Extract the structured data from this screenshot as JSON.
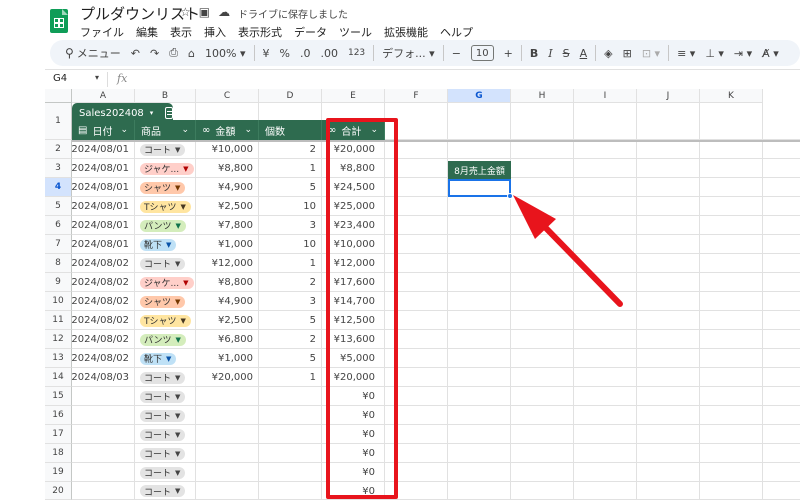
{
  "title": "プルダウンリスト",
  "saved": "ドライブに保存しました",
  "menu": [
    "ファイル",
    "編集",
    "表示",
    "挿入",
    "表示形式",
    "データ",
    "ツール",
    "拡張機能",
    "ヘルプ"
  ],
  "toolbar": {
    "search": "メニュー",
    "zoom": "100%",
    "currency": "¥",
    "percent": "%",
    "dec_dec": ".0",
    "dec_inc": ".00",
    "num_fmt": "123",
    "font": "デフォ...",
    "size": "10",
    "bold": "B",
    "italic": "I",
    "strike": "S",
    "color": "A",
    "minus": "−",
    "plus": "+"
  },
  "namebox": "G4",
  "fx": "fx",
  "columns": [
    "A",
    "B",
    "C",
    "D",
    "E",
    "F",
    "G",
    "H",
    "I",
    "J",
    "K"
  ],
  "selected_col": "G",
  "selected_row": "4",
  "table": {
    "name": "Sales202408",
    "headers": [
      "日付",
      "商品",
      "金額",
      "個数",
      "合計"
    ],
    "rows": [
      {
        "date": "2024/08/01",
        "item": "コート",
        "amount": "¥10,000",
        "qty": "2",
        "total": "¥20,000"
      },
      {
        "date": "2024/08/01",
        "item": "ジャケ...",
        "amount": "¥8,800",
        "qty": "1",
        "total": "¥8,800"
      },
      {
        "date": "2024/08/01",
        "item": "シャツ",
        "amount": "¥4,900",
        "qty": "5",
        "total": "¥24,500"
      },
      {
        "date": "2024/08/01",
        "item": "Tシャツ",
        "amount": "¥2,500",
        "qty": "10",
        "total": "¥25,000"
      },
      {
        "date": "2024/08/01",
        "item": "パンツ",
        "amount": "¥7,800",
        "qty": "3",
        "total": "¥23,400"
      },
      {
        "date": "2024/08/01",
        "item": "靴下",
        "amount": "¥1,000",
        "qty": "10",
        "total": "¥10,000"
      },
      {
        "date": "2024/08/02",
        "item": "コート",
        "amount": "¥12,000",
        "qty": "1",
        "total": "¥12,000"
      },
      {
        "date": "2024/08/02",
        "item": "ジャケ...",
        "amount": "¥8,800",
        "qty": "2",
        "total": "¥17,600"
      },
      {
        "date": "2024/08/02",
        "item": "シャツ",
        "amount": "¥4,900",
        "qty": "3",
        "total": "¥14,700"
      },
      {
        "date": "2024/08/02",
        "item": "Tシャツ",
        "amount": "¥2,500",
        "qty": "5",
        "total": "¥12,500"
      },
      {
        "date": "2024/08/02",
        "item": "パンツ",
        "amount": "¥6,800",
        "qty": "2",
        "total": "¥13,600"
      },
      {
        "date": "2024/08/02",
        "item": "靴下",
        "amount": "¥1,000",
        "qty": "5",
        "total": "¥5,000"
      },
      {
        "date": "2024/08/03",
        "item": "コート",
        "amount": "¥20,000",
        "qty": "1",
        "total": "¥20,000"
      },
      {
        "date": "",
        "item": "コート",
        "amount": "",
        "qty": "",
        "total": "¥0"
      },
      {
        "date": "",
        "item": "コート",
        "amount": "",
        "qty": "",
        "total": "¥0"
      },
      {
        "date": "",
        "item": "コート",
        "amount": "",
        "qty": "",
        "total": "¥0"
      },
      {
        "date": "",
        "item": "コート",
        "amount": "",
        "qty": "",
        "total": "¥0"
      },
      {
        "date": "",
        "item": "コート",
        "amount": "",
        "qty": "",
        "total": "¥0"
      },
      {
        "date": "",
        "item": "コート",
        "amount": "",
        "qty": "",
        "total": "¥0"
      }
    ]
  },
  "chip_colors": {
    "コート": "#e3e3e3",
    "ジャケ...": "#ffcfc9",
    "シャツ": "#ffc8aa",
    "Tシャツ": "#ffe5a0",
    "パンツ": "#d4edbc",
    "靴下": "#bfe1f6"
  },
  "chip_arrow_colors": {
    "コート": "#444444",
    "ジャケ...": "#b10202",
    "シャツ": "#753800",
    "Tシャツ": "#473821",
    "パンツ": "#11734b",
    "靴下": "#0a53a8"
  },
  "sales_label": "8月売上金額",
  "accent": "#2e6b4f",
  "highlight": "#e8141c"
}
